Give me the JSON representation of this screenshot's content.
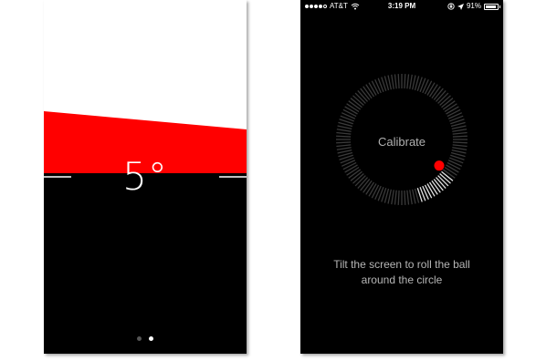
{
  "level_screen": {
    "angle_label": "5°",
    "tilt_degrees": 5,
    "colors": {
      "top": "#ffffff",
      "tilt_band": "#ff0000",
      "bottom": "#000000"
    },
    "page_indicator": {
      "count": 2,
      "active_index": 1
    }
  },
  "calibrate_screen": {
    "status_bar": {
      "carrier": "AT&T",
      "time": "3:19 PM",
      "battery_percent": "91%",
      "battery_level": 0.91,
      "icons": [
        "signal-icon",
        "wifi-icon",
        "orientation-lock-icon",
        "location-arrow-icon",
        "battery-icon"
      ]
    },
    "calibrate_label": "Calibrate",
    "instruction_text": "Tilt the screen to roll the ball around the circle",
    "colors": {
      "ball": "#ff0000",
      "ticks": "#3a3a3a",
      "ticks_filled": "#e0e0e0"
    }
  }
}
